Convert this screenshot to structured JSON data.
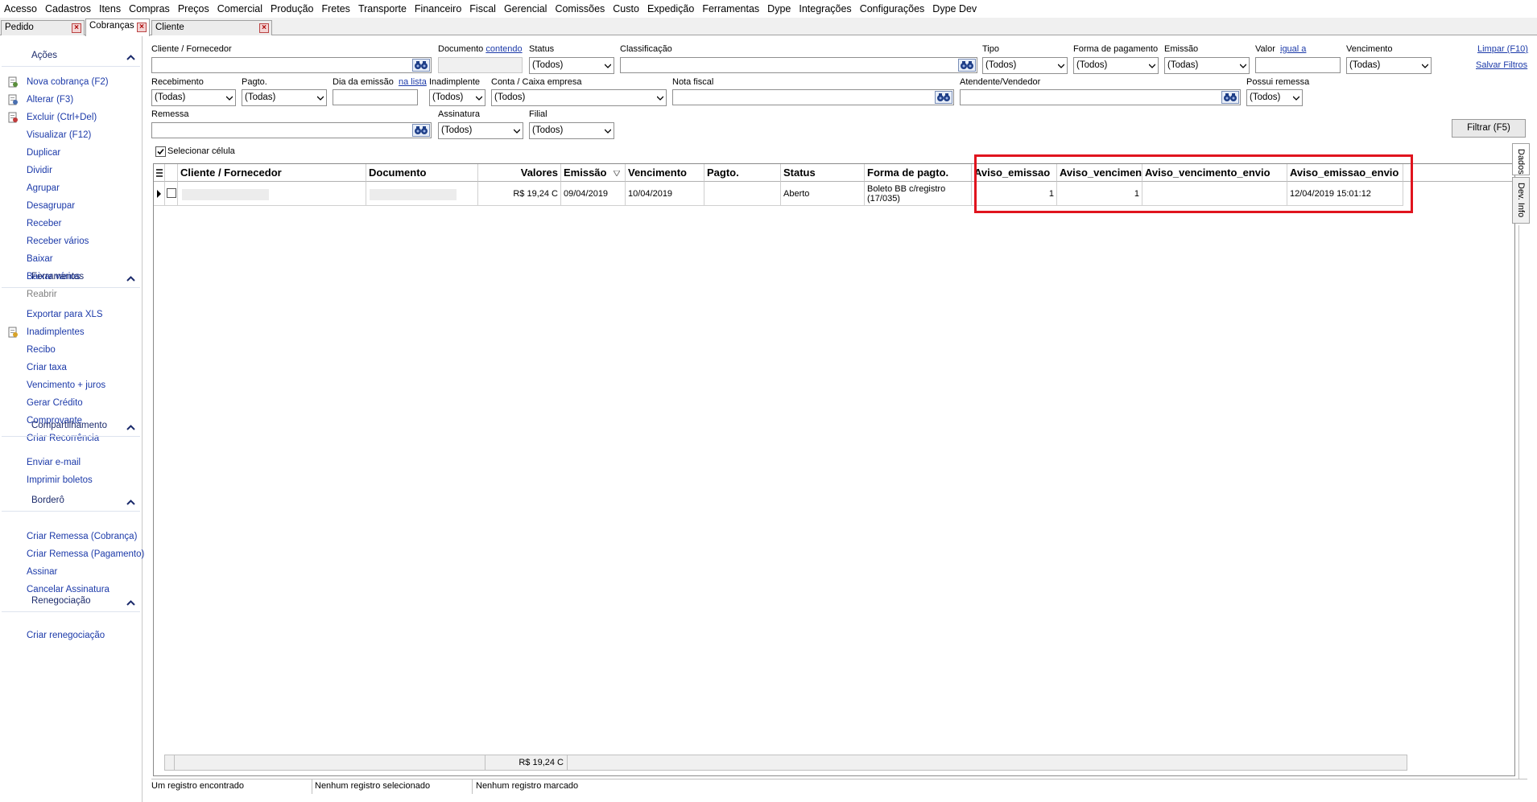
{
  "menu": [
    "Acesso",
    "Cadastros",
    "Itens",
    "Compras",
    "Preços",
    "Comercial",
    "Produção",
    "Fretes",
    "Transporte",
    "Financeiro",
    "Fiscal",
    "Gerencial",
    "Comissões",
    "Custo",
    "Expedição",
    "Ferramentas",
    "Dype",
    "Integrações",
    "Configurações",
    "Dype Dev"
  ],
  "tabs": [
    {
      "label": "Pedido",
      "active": false
    },
    {
      "label": "Cobranças",
      "active": true
    },
    {
      "label": "Cliente",
      "active": false
    }
  ],
  "sidebar": {
    "acoes": {
      "title": "Ações",
      "items": [
        "Nova cobrança (F2)",
        "Alterar (F3)",
        "Excluir (Ctrl+Del)",
        "Visualizar (F12)",
        "Duplicar",
        "Dividir",
        "Agrupar",
        "Desagrupar",
        "Receber",
        "Receber vários",
        "Baixar",
        "Baixar vários",
        "Reabrir"
      ]
    },
    "ferramentas": {
      "title": "Ferramentas",
      "items": [
        "Exportar para XLS",
        "Inadimplentes",
        "Recibo",
        "Criar taxa",
        "Vencimento + juros",
        "Gerar Crédito",
        "Comprovante",
        "Criar Recorrência"
      ]
    },
    "compartilhamento": {
      "title": "Compartilhamento",
      "items": [
        "Enviar e-mail",
        "Imprimir boletos"
      ]
    },
    "bordero": {
      "title": "Borderô",
      "items": [
        "Criar Remessa (Cobrança)",
        "Criar Remessa (Pagamento)",
        "Assinar",
        "Cancelar Assinatura"
      ]
    },
    "renegociacao": {
      "title": "Renegociação",
      "items": [
        "Criar renegociação"
      ]
    }
  },
  "filters": {
    "cliente_label": "Cliente / Fornecedor",
    "documento_label": "Documento",
    "documento_link": "contendo",
    "status_label": "Status",
    "status_value": "(Todos)",
    "classificacao_label": "Classificação",
    "tipo_label": "Tipo",
    "tipo_value": "(Todos)",
    "forma_label": "Forma de pagamento",
    "forma_value": "(Todos)",
    "emissao_label": "Emissão",
    "emissao_value": "(Todas)",
    "valor_label": "Valor",
    "valor_link": "igual a",
    "vencimento_label": "Vencimento",
    "vencimento_value": "(Todas)",
    "recebimento_label": "Recebimento",
    "recebimento_value": "(Todas)",
    "pagto_label": "Pagto.",
    "pagto_value": "(Todas)",
    "dia_emissao_label": "Dia da emissão",
    "dia_emissao_link": "na lista",
    "inadimplente_label": "Inadimplente",
    "inadimplente_value": "(Todos)",
    "conta_label": "Conta / Caixa empresa",
    "conta_value": "(Todos)",
    "nota_label": "Nota fiscal",
    "atendente_label": "Atendente/Vendedor",
    "remessa_possui_label": "Possui remessa",
    "remessa_possui_value": "(Todos)",
    "remessa_label": "Remessa",
    "assinatura_label": "Assinatura",
    "assinatura_value": "(Todos)",
    "filial_label": "Filial",
    "filial_value": "(Todos)",
    "limpar": "Limpar (F10)",
    "salvar": "Salvar Filtros",
    "filtrar": "Filtrar (F5)",
    "selecionar_celula": "Selecionar célula"
  },
  "grid": {
    "columns": [
      "Cliente / Fornecedor",
      "Documento",
      "Valores",
      "Emissão",
      "Vencimento",
      "Pagto.",
      "Status",
      "Forma de pagto.",
      "Aviso_emissao",
      "Aviso_vencimento",
      "Aviso_vencimento_envio",
      "Aviso_emissao_envio"
    ],
    "rows": [
      {
        "valor": "R$ 19,24 C",
        "emissao": "09/04/2019",
        "vencimento": "10/04/2019",
        "pagto": "",
        "status": "Aberto",
        "forma_1": "Boleto BB c/registro",
        "forma_2": "(17/035)",
        "aviso_emissao": "1",
        "aviso_vencimento": "1",
        "aviso_vencimento_envio": "",
        "aviso_emissao_envio": "12/04/2019 15:01:12"
      }
    ],
    "footer_total": "R$ 19,24 C"
  },
  "side_tabs": [
    "Dados",
    "Dev. Info"
  ],
  "status": [
    "Um registro encontrado",
    "Nenhum registro selecionado",
    "Nenhum registro marcado"
  ],
  "colors": {
    "link": "#1c3aa9",
    "highlight": "#e0141e"
  }
}
